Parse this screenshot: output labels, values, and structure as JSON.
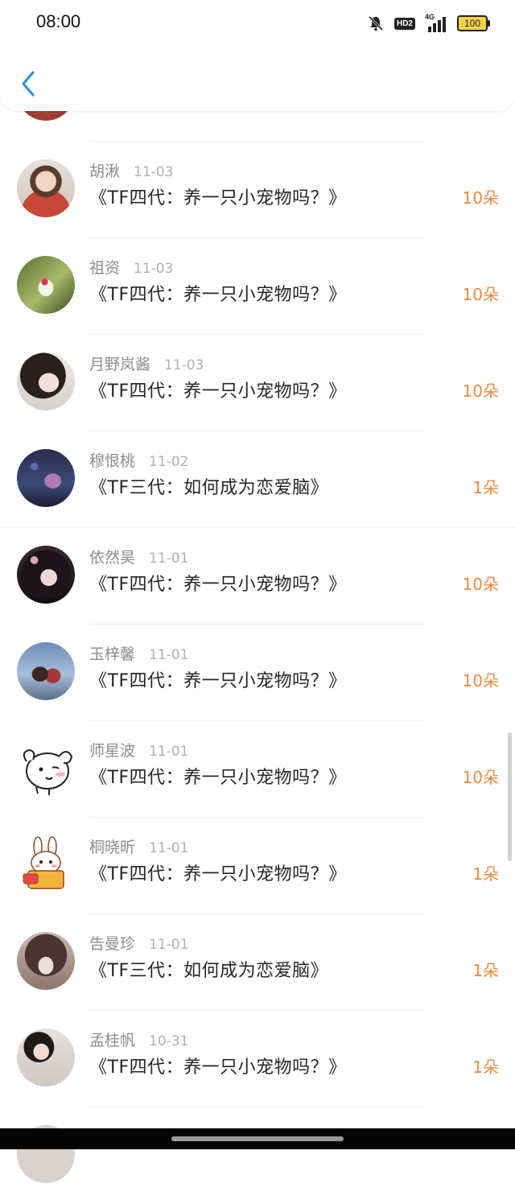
{
  "status_bar": {
    "time": "08:00",
    "network": "4G",
    "hd": "HD2",
    "battery": "100"
  },
  "nav": {
    "back_icon": "chevron-left-icon"
  },
  "rows": [
    {
      "name": "胡湫",
      "date": "11-03",
      "title": "《TF四代：养一只小宠物吗？》",
      "amount": "10朵"
    },
    {
      "name": "祖资",
      "date": "11-03",
      "title": "《TF四代：养一只小宠物吗？》",
      "amount": "10朵"
    },
    {
      "name": "月野岚酱",
      "date": "11-03",
      "title": "《TF四代：养一只小宠物吗？》",
      "amount": "10朵"
    },
    {
      "name": "穆恨桃",
      "date": "11-02",
      "title": "《TF三代：如何成为恋爱脑》",
      "amount": "1朵"
    },
    {
      "name": "依然昊",
      "date": "11-01",
      "title": "《TF四代：养一只小宠物吗？》",
      "amount": "10朵"
    },
    {
      "name": "玉梓馨",
      "date": "11-01",
      "title": "《TF四代：养一只小宠物吗？》",
      "amount": "10朵"
    },
    {
      "name": "师星波",
      "date": "11-01",
      "title": "《TF四代：养一只小宠物吗？》",
      "amount": "10朵"
    },
    {
      "name": "桐晓昕",
      "date": "11-01",
      "title": "《TF四代：养一只小宠物吗？》",
      "amount": "1朵"
    },
    {
      "name": "告曼珍",
      "date": "11-01",
      "title": "《TF三代：如何成为恋爱脑》",
      "amount": "1朵"
    },
    {
      "name": "孟桂帆",
      "date": "10-31",
      "title": "《TF四代：养一只小宠物吗？》",
      "amount": "1朵"
    }
  ],
  "colors": {
    "amount": "#f0893c",
    "accent": "#2a8fd6"
  }
}
